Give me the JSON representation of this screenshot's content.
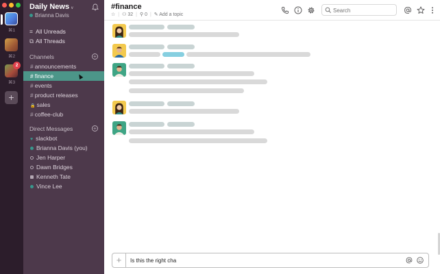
{
  "teams": [
    {
      "shortcut": "⌘1",
      "active": true
    },
    {
      "shortcut": "⌘2",
      "active": false
    },
    {
      "shortcut": "⌘3",
      "active": false,
      "badge": "2"
    }
  ],
  "add_team_icon": "plus-icon",
  "workspace": {
    "name": "Daily News",
    "user": "Brianna Davis"
  },
  "nav": [
    {
      "label": "All Unreads",
      "icon": "unreads-icon"
    },
    {
      "label": "All Threads",
      "icon": "threads-icon"
    }
  ],
  "channels": {
    "heading": "Channels",
    "items": [
      {
        "name": "announcements",
        "prefix": "#",
        "selected": false
      },
      {
        "name": "finance",
        "prefix": "#",
        "selected": true
      },
      {
        "name": "events",
        "prefix": "#",
        "selected": false
      },
      {
        "name": "product releases",
        "prefix": "#",
        "selected": false
      },
      {
        "name": "sales",
        "prefix": "🔒",
        "selected": false
      },
      {
        "name": "coffee-club",
        "prefix": "#",
        "selected": false
      }
    ]
  },
  "direct_messages": {
    "heading": "Direct Messages",
    "items": [
      {
        "name": "slackbot",
        "status": "heart"
      },
      {
        "name": "Brianna Davis (you)",
        "status": "online"
      },
      {
        "name": "Jen Harper",
        "status": "away"
      },
      {
        "name": "Dawn Bridges",
        "status": "away"
      },
      {
        "name": "Kenneth Tate",
        "status": "multi"
      },
      {
        "name": "Vince Lee",
        "status": "online"
      }
    ]
  },
  "header": {
    "channel": "#finance",
    "members": "32",
    "pinned": "0",
    "topic": "Add a topic",
    "search_placeholder": "Search"
  },
  "composer": {
    "value": "Is this the right cha"
  },
  "colors": {
    "sidebar": "#4d394b",
    "rail": "#2c1d2b",
    "selected": "#4c9689",
    "presence": "#38978d"
  }
}
